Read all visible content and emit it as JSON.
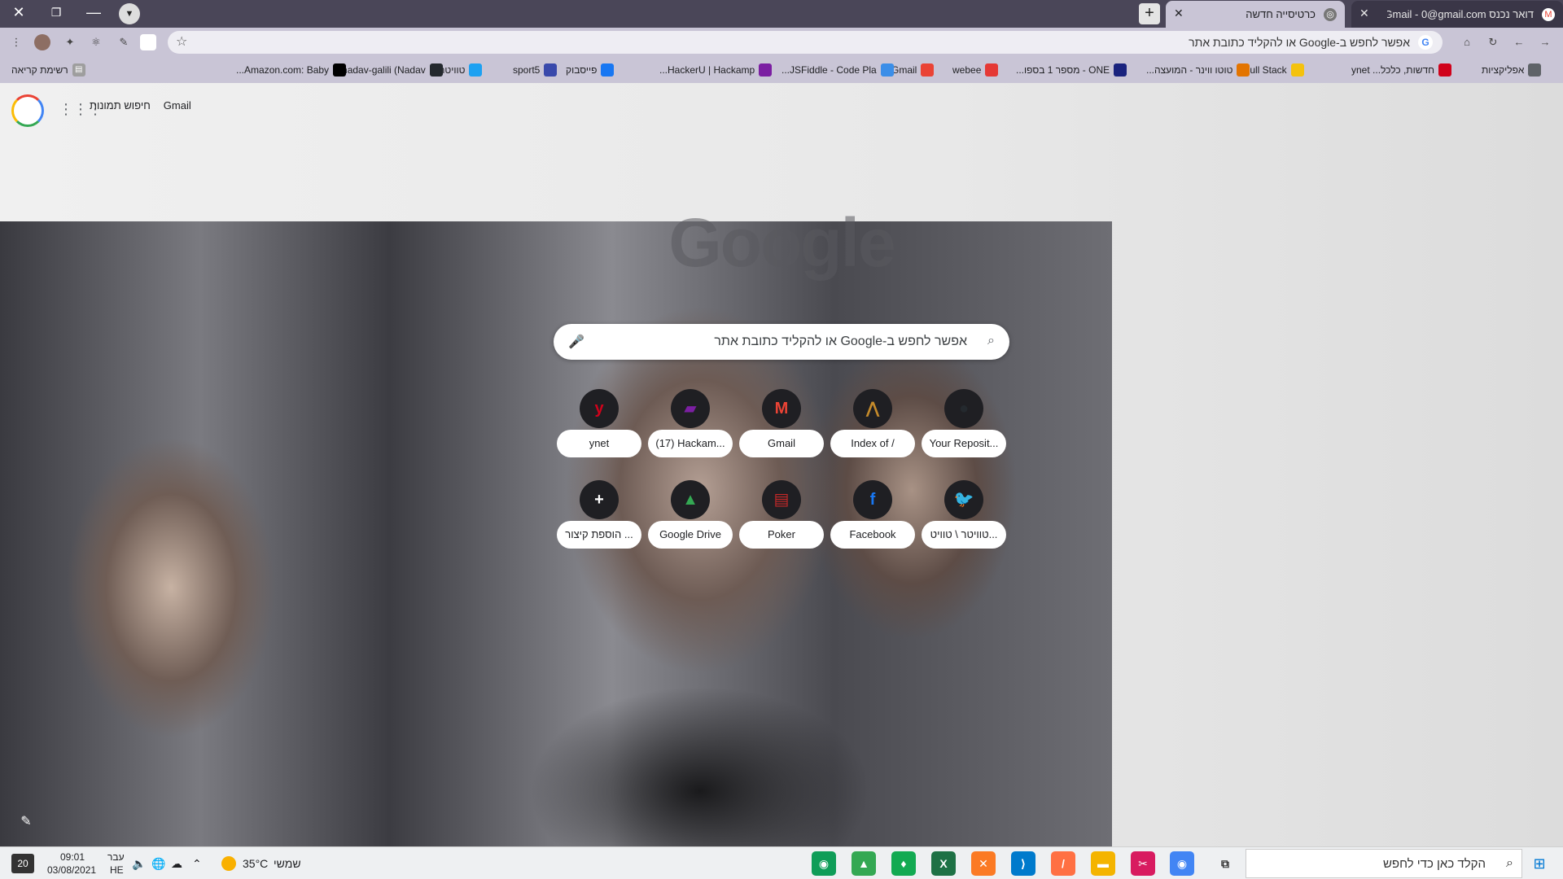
{
  "tabs": [
    {
      "title": "כרטיסייה חדשה",
      "active": true
    },
    {
      "title": "דואר נכנס Gmail - 0@gmail.com",
      "active": false
    }
  ],
  "toolbar": {
    "omnibox_placeholder": "אפשר לחפש ב-Google או להקליד כתובת אתר",
    "star_icon": "☆"
  },
  "bookmarks": [
    {
      "label": "אפליקציות",
      "icon": "apps-icon",
      "color": "#5f6368"
    },
    {
      "label": "חדשות, כלכל... ynet",
      "icon": "ynet-icon",
      "color": "#d0021b"
    },
    {
      "label": "Full Stack",
      "icon": "folder-icon",
      "color": "#f4c20d"
    },
    {
      "label": "טוטו ווינר - המועצה...",
      "icon": "toto-icon",
      "color": "#e37400"
    },
    {
      "label": "ONE - מספר 1 בספו...",
      "icon": "one-icon",
      "color": "#1a237e"
    },
    {
      "label": "webee",
      "icon": "webee-icon",
      "color": "#e53935"
    },
    {
      "label": "Gmail",
      "icon": "gmail-icon",
      "color": "#ea4335"
    },
    {
      "label": "JSFiddle - Code Pla...",
      "icon": "jsfiddle-icon",
      "color": "#3b8ee8"
    },
    {
      "label": "HackerU | Hackamp...",
      "icon": "hackeru-icon",
      "color": "#7b1fa2"
    },
    {
      "label": "פייסבוק",
      "icon": "facebook-icon",
      "color": "#1877f2"
    },
    {
      "label": "sport5",
      "icon": "sport5-icon",
      "color": "#3949ab"
    },
    {
      "label": "טוויטר",
      "icon": "twitter-icon",
      "color": "#1da1f2"
    },
    {
      "label": "nadav-galili (Nadav...",
      "icon": "github-icon",
      "color": "#24292e"
    },
    {
      "label": "Amazon.com: Baby...",
      "icon": "amazon-icon",
      "color": "#000000"
    }
  ],
  "reading_list": "רשימת קריאה",
  "header": {
    "gmail": "Gmail",
    "images": "חיפוש תמונות"
  },
  "logo": "Google",
  "search": {
    "placeholder": "אפשר לחפש ב-Google או להקליד כתובת אתר"
  },
  "shortcuts": [
    {
      "label": "ynet",
      "glyph": "y",
      "color": "#d0021b"
    },
    {
      "label": "(17) Hackam...",
      "glyph": "▰",
      "color": "#7b1fa2"
    },
    {
      "label": "Gmail",
      "glyph": "M",
      "color": "#ea4335"
    },
    {
      "label": "Index of /",
      "glyph": "⋀",
      "color": "#c58b2b"
    },
    {
      "label": "Your Reposit...",
      "glyph": "●",
      "color": "#24292e"
    },
    {
      "label": "הוספת קיצור ...",
      "glyph": "+",
      "color": "#ffffff"
    },
    {
      "label": "Google Drive",
      "glyph": "▲",
      "color": "#34a853"
    },
    {
      "label": "Poker",
      "glyph": "▤",
      "color": "#c62828"
    },
    {
      "label": "Facebook",
      "glyph": "f",
      "color": "#1877f2"
    },
    {
      "label": "טוויטר \\ טוויט...",
      "glyph": "🐦",
      "color": "#1da1f2"
    }
  ],
  "taskbar": {
    "search_text": "הקלד כאן כדי לחפש",
    "time": "09:01",
    "date": "03/08/2021",
    "lang_top": "עבר",
    "lang_bottom": "HE",
    "temp": "35°C",
    "weather": "שמשי",
    "notif_count": "20",
    "apps": [
      {
        "name": "chrome-icon",
        "color": "#4285f4",
        "glyph": "◉"
      },
      {
        "name": "snip-icon",
        "color": "#d81b60",
        "glyph": "✂"
      },
      {
        "name": "file-explorer-icon",
        "color": "#f4b400",
        "glyph": "▬"
      },
      {
        "name": "sublime-icon",
        "color": "#ff7043",
        "glyph": "/"
      },
      {
        "name": "vscode-icon",
        "color": "#007acc",
        "glyph": "⟩"
      },
      {
        "name": "xampp-icon",
        "color": "#fb7a24",
        "glyph": "✕"
      },
      {
        "name": "excel-icon",
        "color": "#1e7145",
        "glyph": "X"
      },
      {
        "name": "mongodb-icon",
        "color": "#13aa52",
        "glyph": "♦"
      },
      {
        "name": "google-drive-icon",
        "color": "#34a853",
        "glyph": "▲"
      },
      {
        "name": "chrome-badge-icon",
        "color": "#0f9d58",
        "glyph": "◉"
      }
    ]
  }
}
